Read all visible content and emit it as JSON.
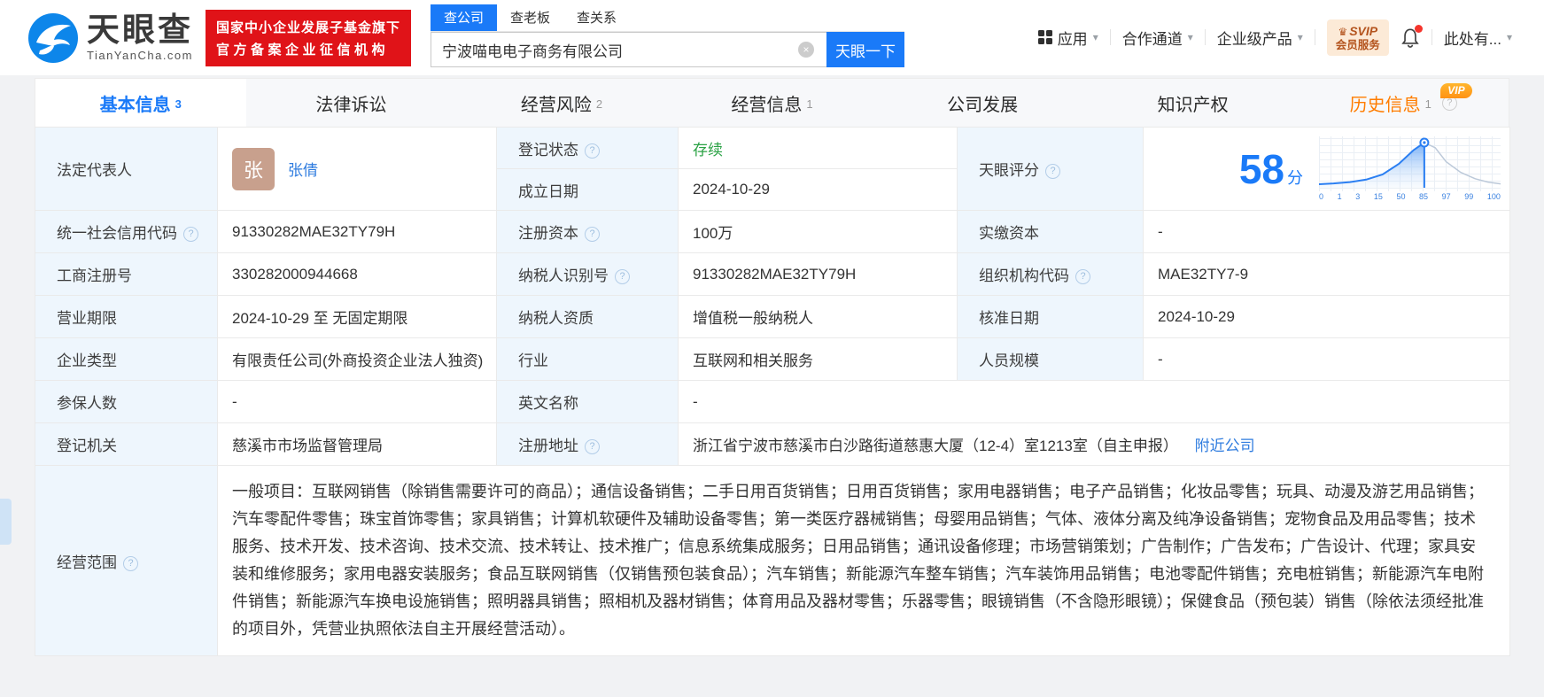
{
  "header": {
    "brand": "天眼查",
    "brand_domain": "TianYanCha.com",
    "badge": [
      "国家中小企业发展子基金旗下",
      "官方备案企业征信机构"
    ],
    "search_tabs": [
      {
        "label": "查公司",
        "active": true
      },
      {
        "label": "查老板",
        "active": false
      },
      {
        "label": "查关系",
        "active": false
      }
    ],
    "search_value": "宁波喵电电子商务有限公司",
    "search_button": "天眼一下",
    "nav_app": "应用",
    "nav_coop": "合作通道",
    "nav_enterprise": "企业级产品",
    "svip_line1": "SVIP",
    "svip_line2": "会员服务",
    "nav_more": "此处有..."
  },
  "tabs": [
    {
      "label": "基本信息",
      "count": "3",
      "active": true
    },
    {
      "label": "法律诉讼"
    },
    {
      "label": "经营风险",
      "count": "2"
    },
    {
      "label": "经营信息",
      "count": "1"
    },
    {
      "label": "公司发展"
    },
    {
      "label": "知识产权"
    },
    {
      "label": "历史信息",
      "count": "1",
      "vip": "VIP"
    }
  ],
  "info": {
    "legal_rep_label": "法定代表人",
    "legal_rep_avatar": "张",
    "legal_rep_name": "张倩",
    "reg_status_label": "登记状态",
    "reg_status": "存续",
    "establish_label": "成立日期",
    "establish_date": "2024-10-29",
    "score_label": "天眼评分",
    "score": "58",
    "score_unit": "分",
    "credit_code_label": "统一社会信用代码",
    "credit_code": "91330282MAE32TY79H",
    "reg_capital_label": "注册资本",
    "reg_capital": "100万",
    "paid_capital_label": "实缴资本",
    "paid_capital": "-",
    "reg_number_label": "工商注册号",
    "reg_number": "330282000944668",
    "taxpayer_id_label": "纳税人识别号",
    "taxpayer_id": "91330282MAE32TY79H",
    "org_code_label": "组织机构代码",
    "org_code": "MAE32TY7-9",
    "business_term_label": "营业期限",
    "business_term": "2024-10-29 至 无固定期限",
    "taxpayer_quality_label": "纳税人资质",
    "taxpayer_quality": "增值税一般纳税人",
    "approval_date_label": "核准日期",
    "approval_date": "2024-10-29",
    "company_type_label": "企业类型",
    "company_type": "有限责任公司(外商投资企业法人独资)",
    "industry_label": "行业",
    "industry": "互联网和相关服务",
    "staff_size_label": "人员规模",
    "staff_size": "-",
    "insured_label": "参保人数",
    "insured": "-",
    "english_name_label": "英文名称",
    "english_name": "-",
    "reg_authority_label": "登记机关",
    "reg_authority": "慈溪市市场监督管理局",
    "reg_address_label": "注册地址",
    "reg_address": "浙江省宁波市慈溪市白沙路街道慈惠大厦（12-4）室1213室（自主申报）",
    "nearby_link": "附近公司",
    "business_scope_label": "经营范围",
    "business_scope": "一般项目：互联网销售（除销售需要许可的商品）；通信设备销售；二手日用百货销售；日用百货销售；家用电器销售；电子产品销售；化妆品零售；玩具、动漫及游艺用品销售；汽车零配件零售；珠宝首饰零售；家具销售；计算机软硬件及辅助设备零售；第一类医疗器械销售；母婴用品销售；气体、液体分离及纯净设备销售；宠物食品及用品零售；技术服务、技术开发、技术咨询、技术交流、技术转让、技术推广；信息系统集成服务；日用品销售；通讯设备修理；市场营销策划；广告制作；广告发布；广告设计、代理；家具安装和维修服务；家用电器安装服务；食品互联网销售（仅销售预包装食品）；汽车销售；新能源汽车整车销售；汽车装饰用品销售；电池零配件销售；充电桩销售；新能源汽车电附件销售；新能源汽车换电设施销售；照明器具销售；照相机及器材销售；体育用品及器材零售；乐器零售；眼镜销售（不含隐形眼镜）；保健食品（预包装）销售（除依法须经批准的项目外，凭营业执照依法自主开展经营活动）。"
  },
  "icons": {
    "help": "?",
    "caret": "▾",
    "clear": "×",
    "crown": "♛"
  },
  "colors": {
    "primary_blue": "#1a7af8",
    "badge_red": "#e01318",
    "status_green": "#2ba245",
    "history_orange": "#ff7d00",
    "label_cell_bg": "#eef6fd",
    "svip_bg": "#fcead7",
    "svip_text": "#b4541e"
  },
  "chart_data": {
    "type": "area",
    "title": "天眼评分分布曲线",
    "score": 58,
    "unit": "分",
    "x_ticks": [
      "0",
      "1",
      "3",
      "15",
      "50",
      "85",
      "97",
      "99",
      "100"
    ],
    "x_axis_note": "percentile scale, ticks evenly spaced; blue filled region left of marker, gray line right of marker; marker pin at peak (score 58)",
    "points": [
      [
        0,
        0.02
      ],
      [
        0.08,
        0.04
      ],
      [
        0.17,
        0.07
      ],
      [
        0.26,
        0.13
      ],
      [
        0.35,
        0.25
      ],
      [
        0.44,
        0.5
      ],
      [
        0.52,
        0.82
      ],
      [
        0.58,
        1.0
      ],
      [
        0.64,
        0.88
      ],
      [
        0.7,
        0.55
      ],
      [
        0.78,
        0.3
      ],
      [
        0.86,
        0.15
      ],
      [
        0.93,
        0.07
      ],
      [
        1,
        0.03
      ]
    ],
    "marker_x": 0.58
  }
}
